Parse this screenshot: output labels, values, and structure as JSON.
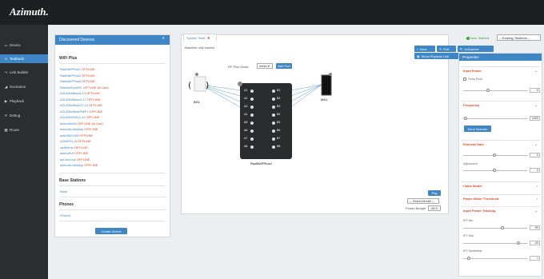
{
  "app": {
    "logo": "Azimuth."
  },
  "sidebar": {
    "items": [
      {
        "icon": "▭",
        "label": "Device",
        "active": false
      },
      {
        "icon": "≡",
        "label": "Testbeds",
        "active": true
      },
      {
        "icon": "↪",
        "label": "Link Builder",
        "active": false
      },
      {
        "icon": "◢",
        "label": "Scenarios",
        "active": false
      },
      {
        "icon": "▶",
        "label": "Playback",
        "active": false
      },
      {
        "icon": "✕",
        "label": "Debug",
        "active": false
      },
      {
        "icon": "▦",
        "label": "Route",
        "active": false
      }
    ]
  },
  "discovered": {
    "title": "Discovered Devices",
    "sections": {
      "wifi": "WiFi Plus",
      "base": "Base Stations",
      "phones": "Phones"
    },
    "devices": [
      {
        "name": "RadMAPPlus1",
        "status": "OFFLINE"
      },
      {
        "name": "RadMAPPlus2",
        "status": "OFFLINE"
      },
      {
        "name": "RadMAPPlus3",
        "status": "OFFLINE"
      },
      {
        "name": "RedHatTechRC",
        "status": "OFFLINE (in Use)"
      },
      {
        "name": "AZLB3wiMaxA-13",
        "status": "OFFLINE"
      },
      {
        "name": "AZLB3WiMax4-17",
        "status": "OFFLINE"
      },
      {
        "name": "AZLB3WiMaxVT-12",
        "status": "OFFLINE"
      },
      {
        "name": "AZLB3WiMaxPMP1",
        "status": "OFFLINE"
      },
      {
        "name": "AZLB3S2WLD-11",
        "status": "OFFLINE"
      },
      {
        "name": "azimuth038",
        "status": "OFFLINE (in Use)"
      },
      {
        "name": "azimuth-desktop",
        "status": "OFFLINE"
      },
      {
        "name": "aclb3MCH59",
        "status": "OFFLINE"
      },
      {
        "name": "AZMATH_B",
        "status": "OFFLINE"
      },
      {
        "name": "radMemo",
        "status": "OFFLINE"
      },
      {
        "name": "azimuth-lt",
        "status": "OFFLINE"
      },
      {
        "name": "azi-box-top",
        "status": "OFFLINE"
      },
      {
        "name": "azimuth-desktop",
        "status": "OFFLINE"
      }
    ],
    "base_item": "Base",
    "phone_item": "Phone1",
    "create_button": "Create Device"
  },
  "tab": {
    "label": "System Test1",
    "close": "✖"
  },
  "canvas": {
    "status": "Baseline only loaded",
    "mode_label": "RF Plus Mode:",
    "mode_value": "mesh ▾",
    "add_button": "Add Port",
    "left_device": "BS1",
    "right_device": "MS1",
    "center_device": "RadMAPPlus1",
    "ports_left": [
      "A1",
      "A2",
      "A3",
      "A4",
      "A5",
      "A6",
      "A7",
      "A8"
    ],
    "ports_right": [
      "B1",
      "B2",
      "B3",
      "B4",
      "B5",
      "B6",
      "B7",
      "B8"
    ],
    "pkg_button": "Pkg",
    "select_model": "-- Select Model --",
    "power_budget_label": "Power Budget",
    "power_budget_value": "-60.0"
  },
  "toolbar": {
    "save": "Save",
    "exit": "Exit",
    "unbounce": "Unbounce",
    "show_physical": "Show Physical Link"
  },
  "top_right": {
    "new_testbed": "New Testbed",
    "existing": "-- Existing Testbeds --"
  },
  "properties": {
    "title": "Properties",
    "input_power": "Input Power",
    "fixed_point": "Fixed Point",
    "input_power_value": "-9",
    "frequency": "Frequency",
    "frequency_value": "2400",
    "send_selector": "Send Selector",
    "external_gain": "External Gain",
    "external_gain_value": "0",
    "adjustment": "Adjustment",
    "adjustment_value": "0",
    "cable_model": "Cable Model",
    "power_meter": "Power Meter Threshold",
    "input_power_tracking": "Input Power Tracking",
    "ipt_min": "IPT Min",
    "ipt_min_value": "-90",
    "ipt_max": "IPT Max",
    "ipt_max_value": "-30",
    "ipt_hysteresis": "IPT Hysteresis",
    "ipt_hysteresis_value": "1",
    "chev": "⌄",
    "chev_right": "›"
  }
}
